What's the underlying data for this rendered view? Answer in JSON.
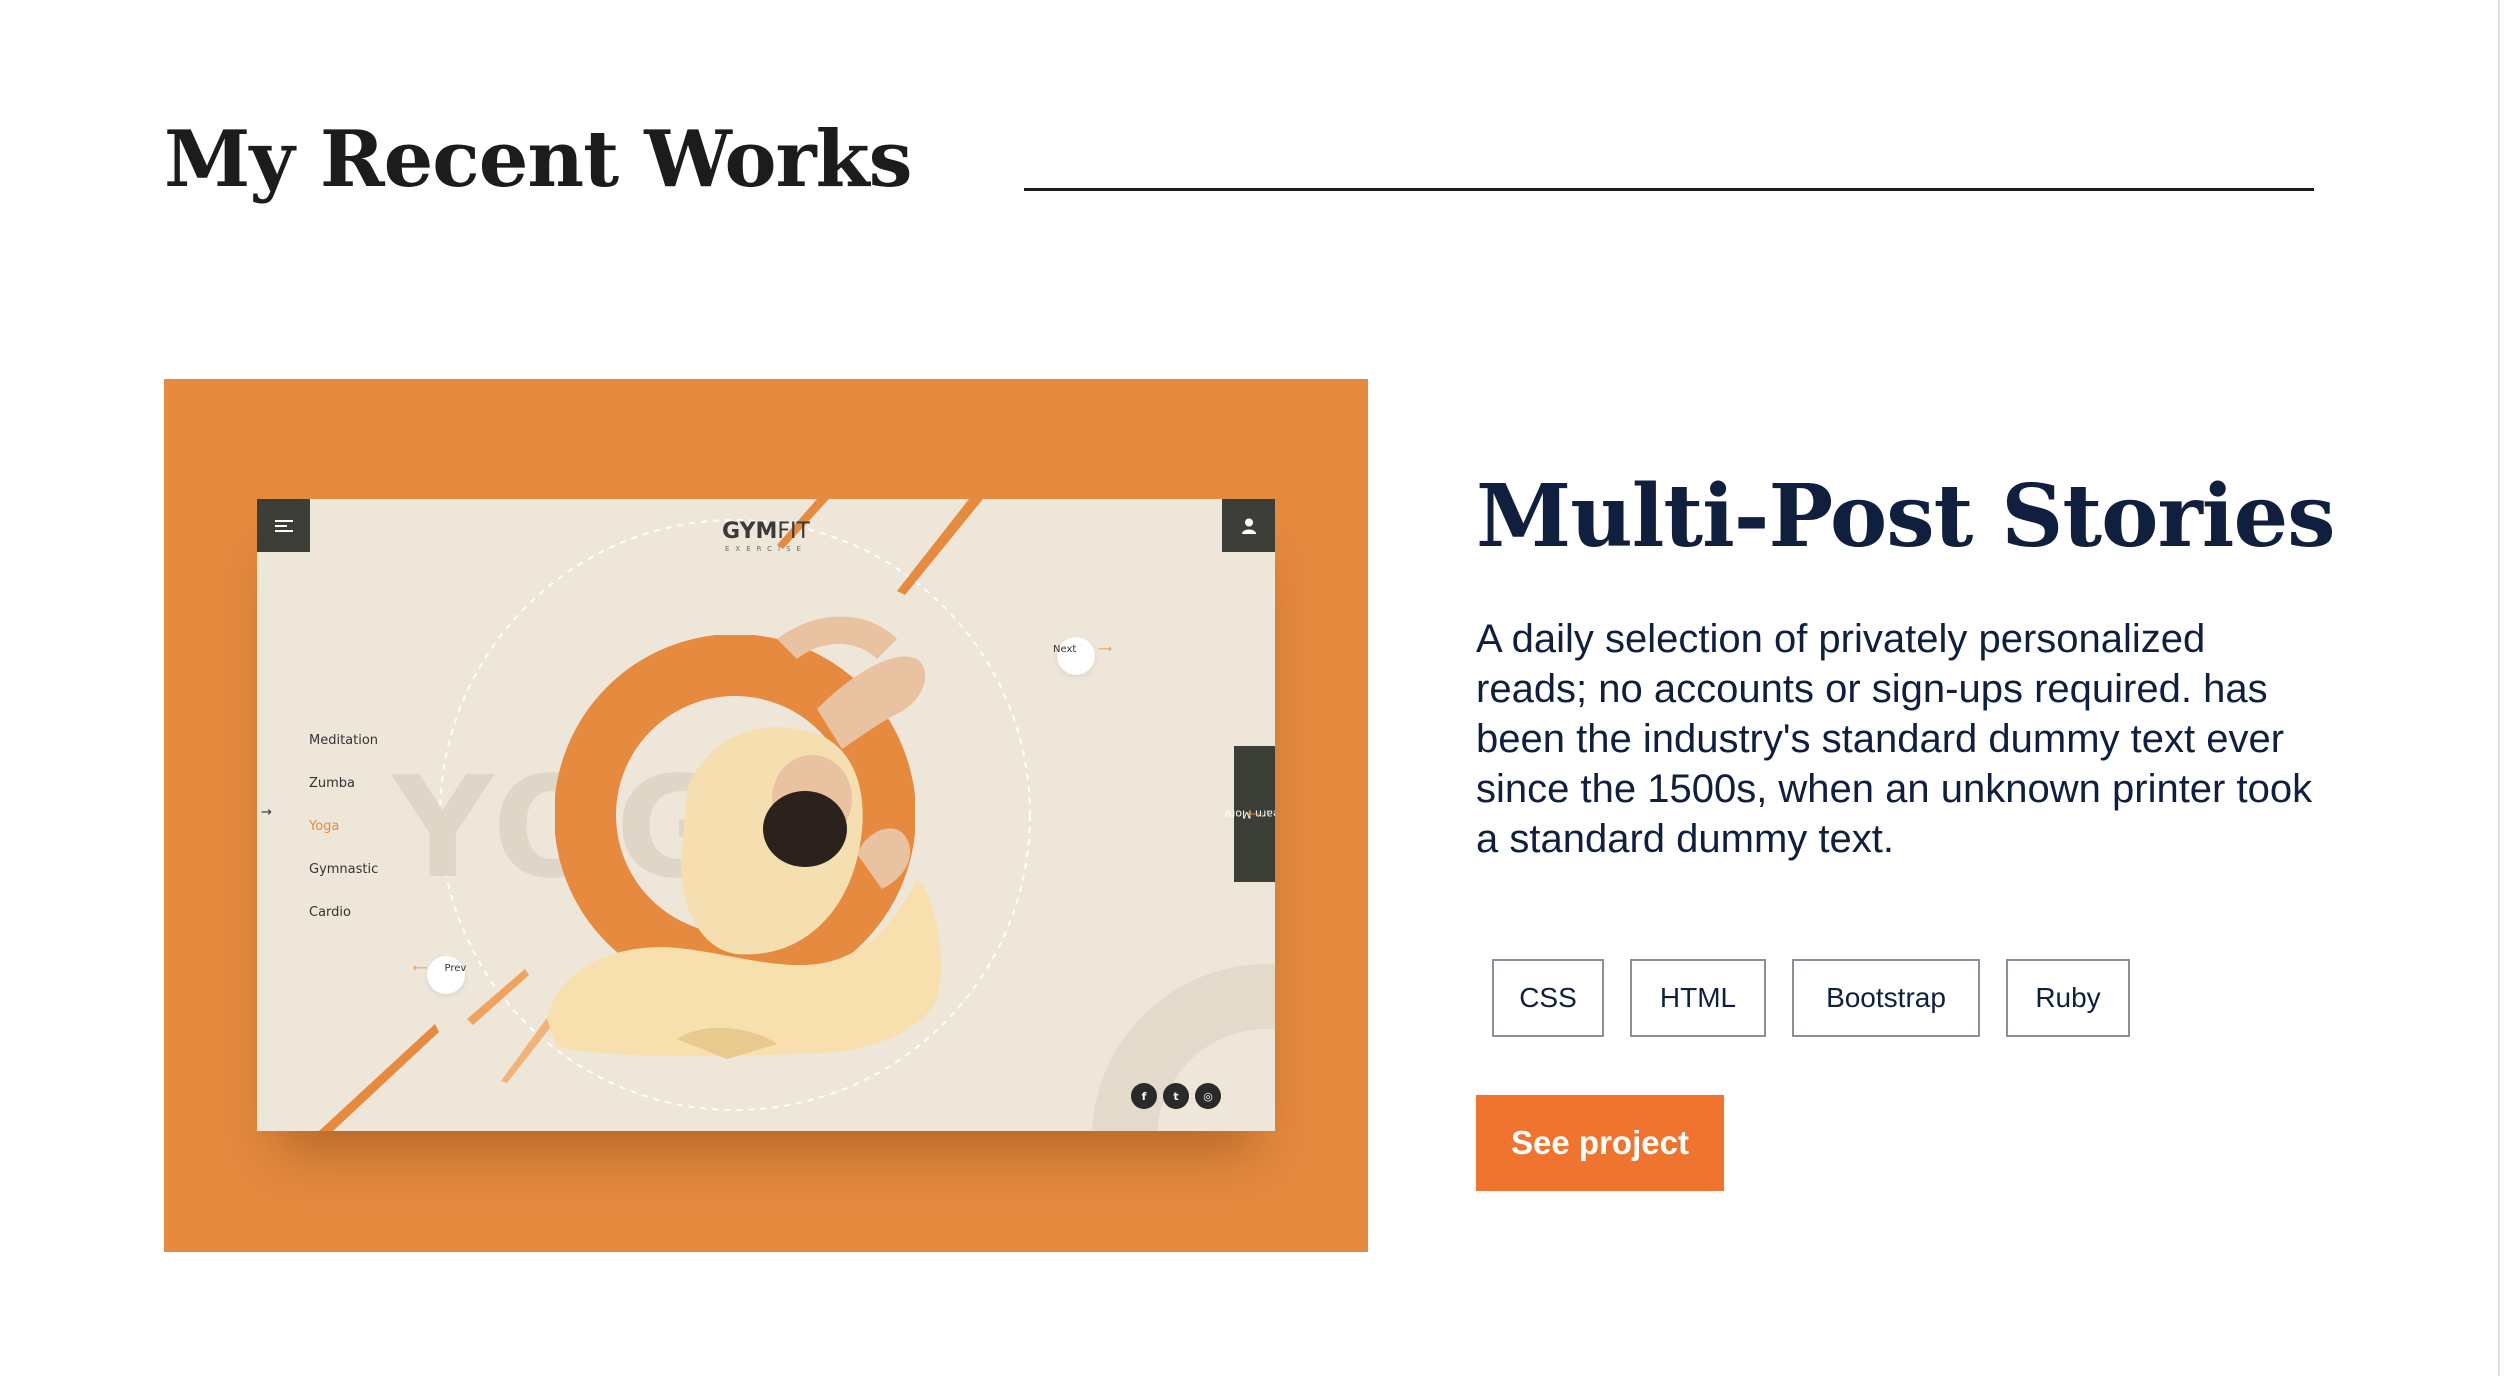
{
  "section": {
    "title": "My Recent Works"
  },
  "preview": {
    "logo_bold": "GYM",
    "logo_light": "FIT",
    "logo_sub": "EXERCISE",
    "big_word": "YOGA",
    "menu_items": [
      "Meditation",
      "Zumba",
      "Yoga",
      "Gymnastic",
      "Cardio"
    ],
    "active_item": "Yoga",
    "next_label": "Next",
    "prev_label": "Prev",
    "learn_more": "Learn More",
    "social": [
      "f",
      "t",
      "◎"
    ],
    "colors": {
      "accent": "#e58a3f",
      "dark": "#3c3f38",
      "cream": "#efe6da"
    }
  },
  "project": {
    "title": "Multi-Post Stories",
    "description": "A daily selection of privately personalized reads; no accounts or sign-ups required. has been the industry's standard dummy text ever since the 1500s, when an unknown printer took a standard dummy text.",
    "tags": [
      "CSS",
      "HTML",
      "Bootstrap",
      "Ruby"
    ],
    "button_label": "See project",
    "colors": {
      "title": "#0f1f3d",
      "button": "#ee7430"
    }
  }
}
